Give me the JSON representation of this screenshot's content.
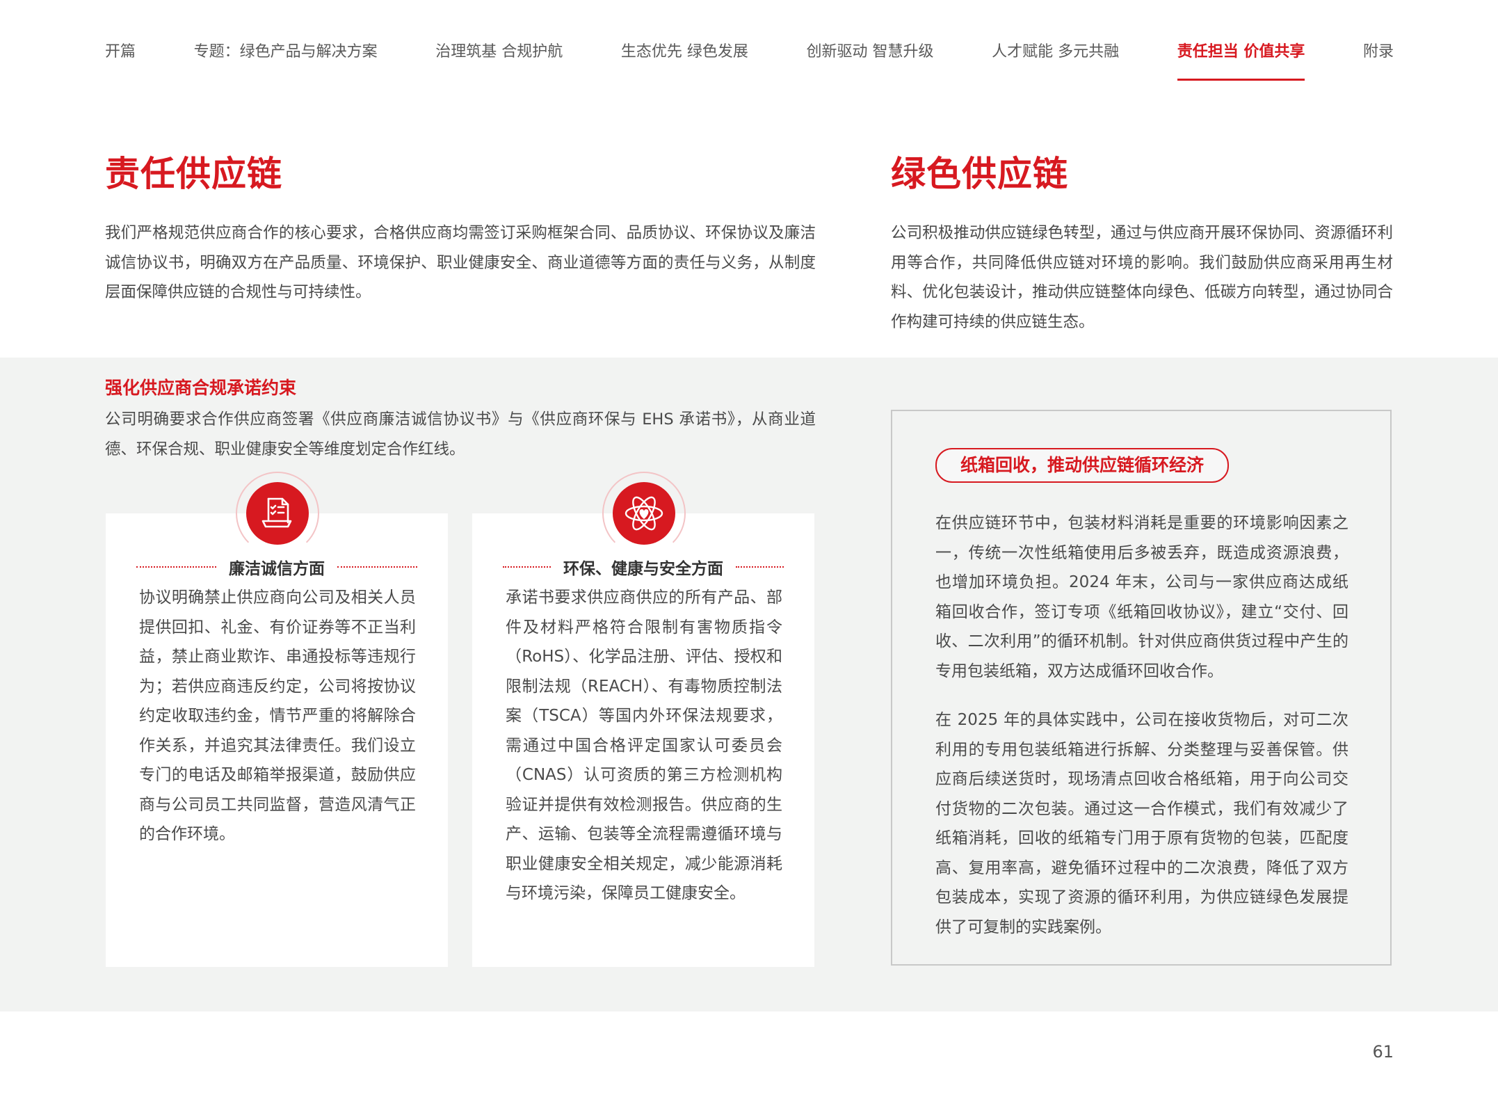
{
  "nav": {
    "items": [
      {
        "label": "开篇"
      },
      {
        "label": "专题：绿色产品与解决方案"
      },
      {
        "label": "治理筑基 合规护航"
      },
      {
        "label": "生态优先 绿色发展"
      },
      {
        "label": "创新驱动 智慧升级"
      },
      {
        "label": "人才赋能 多元共融"
      },
      {
        "label": "责任担当 价值共享"
      },
      {
        "label": "附录"
      }
    ],
    "active_index": 6
  },
  "responsible_supply_chain": {
    "title": "责任供应链",
    "body": "我们严格规范供应商合作的核心要求，合格供应商均需签订采购框架合同、品质协议、环保协议及廉洁诚信协议书，明确双方在产品质量、环境保护、职业健康安全、商业道德等方面的责任与义务，从制度层面保障供应链的合规性与可持续性。"
  },
  "green_supply_chain": {
    "title": "绿色供应链",
    "body": "公司积极推动供应链绿色转型，通过与供应商开展环保协同、资源循环利用等合作，共同降低供应链对环境的影响。我们鼓励供应商采用再生材料、优化包装设计，推动供应链整体向绿色、低碳方向转型，通过协同合作构建可持续的供应链生态。"
  },
  "commitment": {
    "heading": "强化供应商合规承诺约束",
    "intro": "公司明确要求合作供应商签署《供应商廉洁诚信协议书》与《供应商环保与 EHS 承诺书》，从商业道德、环保合规、职业健康安全等维度划定合作红线。"
  },
  "cards": [
    {
      "icon": "document-checklist-icon",
      "title": "廉洁诚信方面",
      "body": "协议明确禁止供应商向公司及相关人员提供回扣、礼金、有价证券等不正当利益，禁止商业欺诈、串通投标等违规行为；若供应商违反约定，公司将按协议约定收取违约金，情节严重的将解除合作关系，并追究其法律责任。我们设立专门的电话及邮箱举报渠道，鼓励供应商与公司员工共同监督，营造风清气正的合作环境。"
    },
    {
      "icon": "atom-heart-icon",
      "title": "环保、健康与安全方面",
      "body": "承诺书要求供应商供应的所有产品、部件及材料严格符合限制有害物质指令（RoHS）、化学品注册、评估、授权和限制法规（REACH）、有毒物质控制法案（TSCA）等国内外环保法规要求，需通过中国合格评定国家认可委员会（CNAS）认可资质的第三方检测机构验证并提供有效检测报告。供应商的生产、运输、包装等全流程需遵循环境与职业健康安全相关规定，减少能源消耗与环境污染，保障员工健康安全。"
    }
  ],
  "case": {
    "title": "纸箱回收，推动供应链循环经济",
    "para1": "在供应链环节中，包装材料消耗是重要的环境影响因素之一，传统一次性纸箱使用后多被丢弃，既造成资源浪费，也增加环境负担。2024 年末，公司与一家供应商达成纸箱回收合作，签订专项《纸箱回收协议》，建立“交付、回收、二次利用”的循环机制。针对供应商供货过程中产生的专用包装纸箱，双方达成循环回收合作。",
    "para2": "在 2025 年的具体实践中，公司在接收货物后，对可二次利用的专用包装纸箱进行拆解、分类整理与妥善保管。供应商后续送货时，现场清点回收合格纸箱，用于向公司交付货物的二次包装。通过这一合作模式，我们有效减少了纸箱消耗，回收的纸箱专门用于原有货物的包装，匹配度高、复用率高，避免循环过程中的二次浪费，降低了双方包装成本，实现了资源的循环利用，为供应链绿色发展提供了可复制的实践案例。"
  },
  "page_number": "61",
  "colors": {
    "accent": "#d71920",
    "band": "#f2f3f2",
    "text": "#4a4a4a"
  }
}
